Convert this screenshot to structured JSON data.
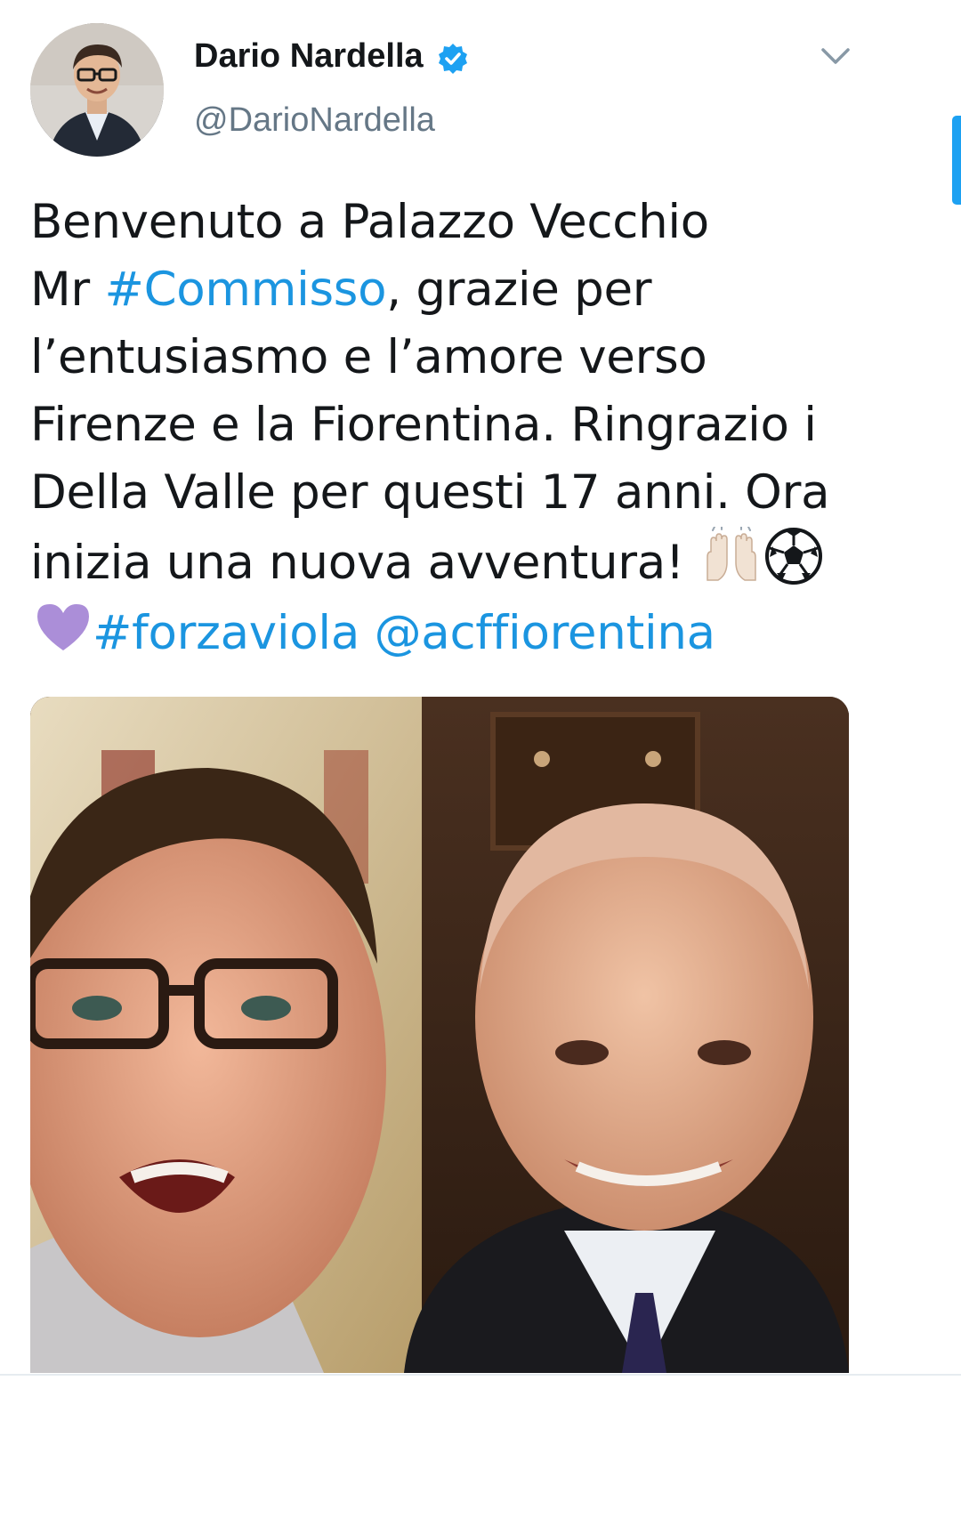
{
  "author": {
    "display_name": "Dario Nardella",
    "handle": "@DarioNardella",
    "verified": true,
    "avatar_icon": "profile-photo"
  },
  "tweet": {
    "lines": [
      [
        {
          "t": "Benvenuto a Palazzo Vecchio"
        }
      ],
      [
        {
          "t": "Mr "
        },
        {
          "t": "#Commisso",
          "link": true
        },
        {
          "t": ", grazie per"
        }
      ],
      [
        {
          "t": "l’entusiasmo e l’amore verso"
        }
      ],
      [
        {
          "t": "Firenze e la Fiorentina. Ringrazio i"
        }
      ],
      [
        {
          "t": "Della Valle per questi 17 anni. Ora"
        }
      ],
      [
        {
          "t": "inizia una nuova avventura! "
        },
        {
          "emoji": "raising-hands-icon"
        },
        {
          "emoji": "soccer-ball-icon"
        }
      ],
      [
        {
          "emoji": "purple-heart-icon"
        },
        {
          "t": "#forzaviola",
          "link": true
        },
        {
          "t": " "
        },
        {
          "t": "@acffiorentina",
          "link": true
        }
      ]
    ]
  },
  "colors": {
    "link": "#1b95e0",
    "text": "#14171a",
    "secondary": "#657786",
    "verified": "#1da1f2",
    "heart": "#ab8ed8"
  },
  "media": {
    "type": "video-thumbnail"
  }
}
